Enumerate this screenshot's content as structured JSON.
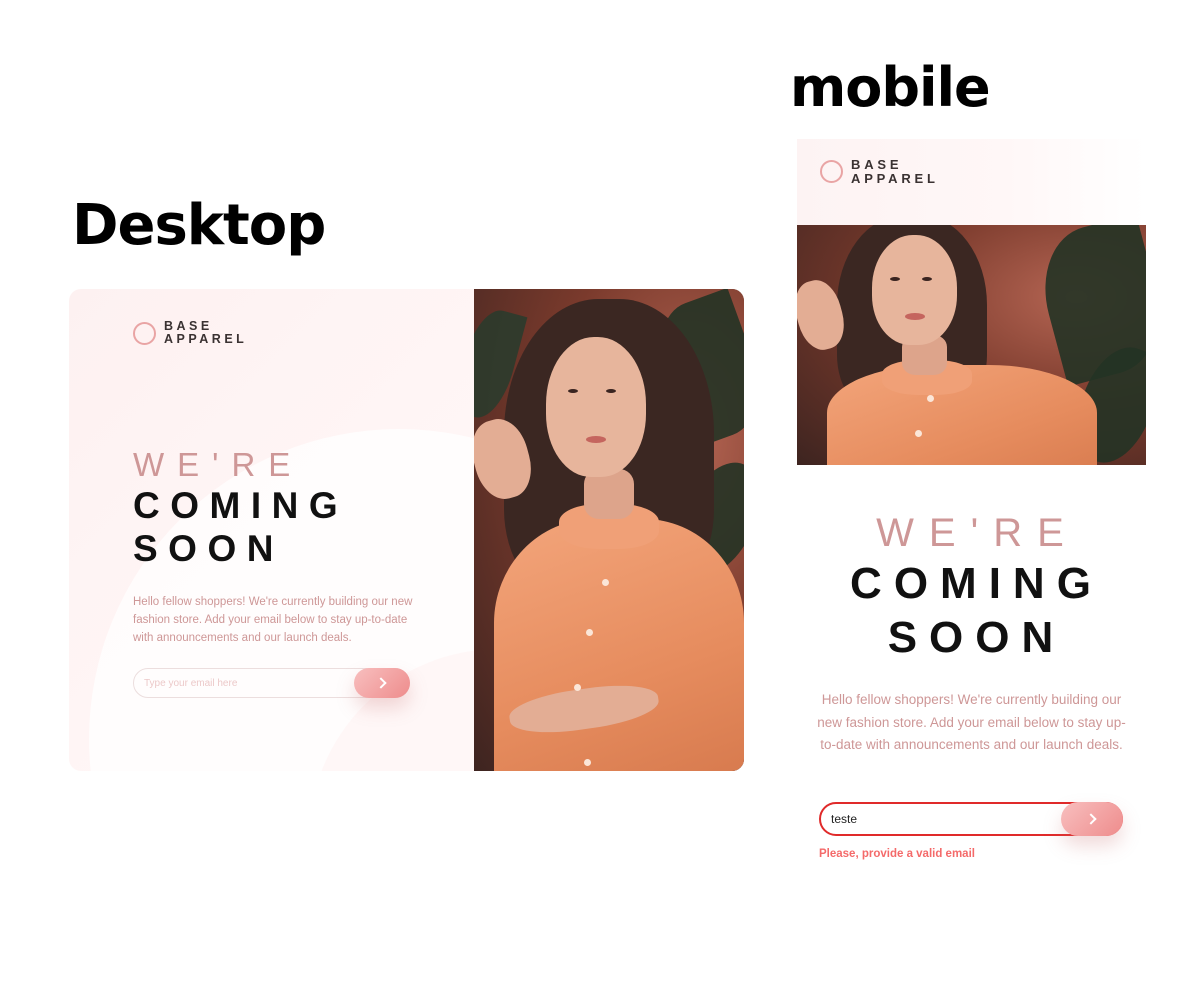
{
  "labels": {
    "desktop": "Desktop",
    "mobile": "mobile"
  },
  "brand": {
    "line1": "BASE",
    "line2": "APPAREL"
  },
  "headline": {
    "line1": "WE'RE",
    "line2": "COMING",
    "line3": "SOON"
  },
  "body": "Hello fellow shoppers! We're currently building our new fashion store. Add your email below to stay up-to-date with announcements and our launch deals.",
  "desktop_form": {
    "placeholder": "Type your email here",
    "value": ""
  },
  "mobile_form": {
    "value": "teste",
    "error": "Please, provide a valid email"
  },
  "colors": {
    "accent": "#CE9797",
    "button_start": "#F8BFBF",
    "button_end": "#EE8C8C",
    "error": "#F96464",
    "dark": "#111111"
  },
  "icons": {
    "submit": "chevron-right-icon",
    "logo": "ring-icon"
  }
}
